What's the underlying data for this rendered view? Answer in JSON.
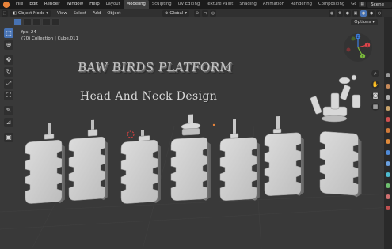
{
  "menubar": {
    "items": [
      "File",
      "Edit",
      "Render",
      "Window",
      "Help"
    ],
    "workspaces": [
      "Layout",
      "Modeling",
      "Sculpting",
      "UV Editing",
      "Texture Paint",
      "Shading",
      "Animation",
      "Rendering",
      "Compositing",
      "Geometry Nod"
    ],
    "active_workspace": "Modeling",
    "scene_name": "Scene"
  },
  "header": {
    "mode": "Object Mode",
    "menus": [
      "View",
      "Select",
      "Add",
      "Object"
    ],
    "transform_orientation": "Global"
  },
  "viewport": {
    "fps": "fps: 24",
    "collection_info": "(70) Collection | Cube.011",
    "options_label": "Options",
    "scene_title": "BAW BIRDS PLATFORM",
    "scene_subtitle": "Head And Neck Design"
  },
  "gizmo_axes": [
    "X",
    "Y",
    "Z"
  ],
  "colors": {
    "accent": "#4772b3",
    "axis_x": "#e0454b",
    "axis_y": "#7ab83c",
    "axis_z": "#3d7fe0",
    "origin": "#e8833a"
  },
  "icons": {
    "blender_logo": "blender-logo-icon",
    "select_box": "select-box-icon",
    "cursor": "cursor-icon",
    "move": "move-icon",
    "rotate": "rotate-icon",
    "scale": "scale-icon",
    "transform": "transform-icon",
    "annotate": "annotate-icon",
    "measure": "measure-icon",
    "add_cube": "add-cube-icon",
    "zoom": "zoom-icon",
    "pan": "hand-icon",
    "camera": "camera-icon",
    "grid": "grid-icon"
  }
}
